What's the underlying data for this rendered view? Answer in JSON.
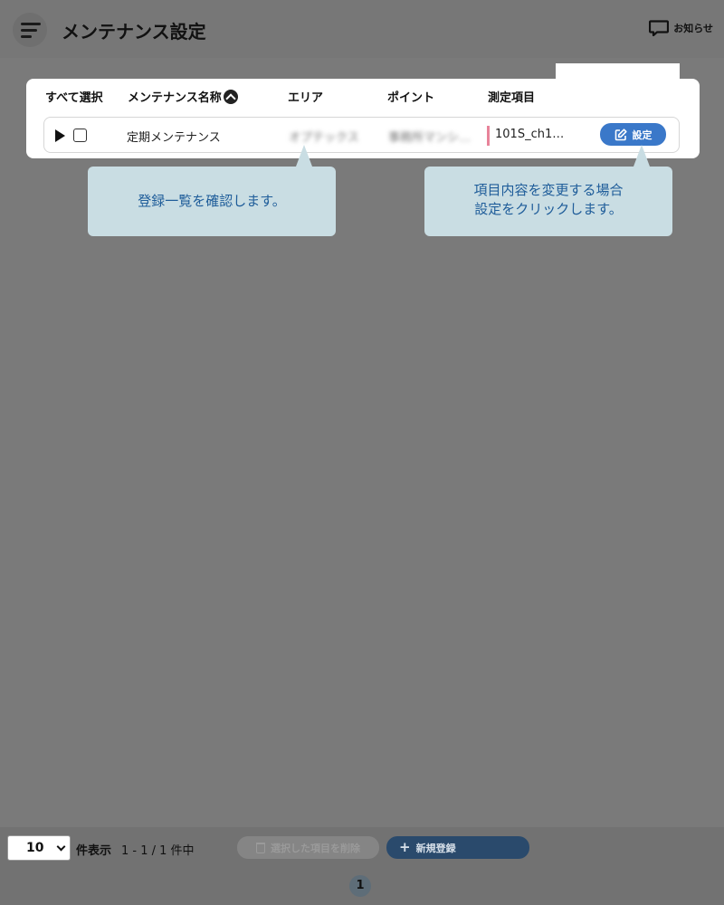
{
  "header": {
    "title": "メンテナンス設定",
    "notice_label": "お知らせ"
  },
  "table": {
    "select_all": "すべて選択",
    "columns": [
      "メンテナンス名称",
      "エリア",
      "ポイント",
      "測定項目"
    ],
    "rows": [
      {
        "name": "定期メンテナンス",
        "area": "オプテックス",
        "point": "事務所マンシ…",
        "measure": "101S_ch1…",
        "settings_label": "設定"
      }
    ]
  },
  "callouts": {
    "left": "登録一覧を確認します。",
    "right_line1": "項目内容を変更する場合",
    "right_line2": "設定をクリックします。"
  },
  "footer": {
    "per_page_value": "10",
    "per_page_label": "件表示",
    "range": "1 - 1 / 1 件中",
    "delete_label": "選択した項目を削除",
    "new_label": "新規登録",
    "current_page": "1"
  },
  "colors": {
    "overlay": "#7a7a7a",
    "accent": "#3a78c9",
    "callout_bg": "#c9dde3",
    "callout_text": "#1f5d9a",
    "measure_bar": "#e8839a"
  }
}
